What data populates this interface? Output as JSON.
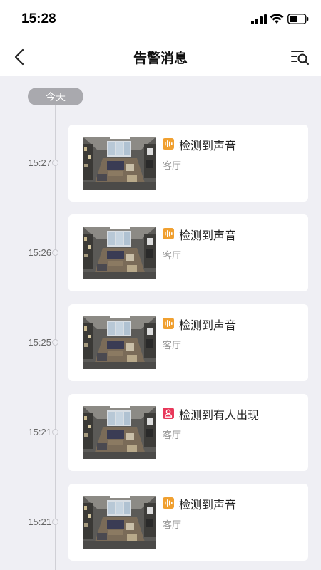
{
  "status_bar": {
    "time": "15:28",
    "icons": [
      "signal-icon",
      "wifi-icon",
      "battery-icon"
    ]
  },
  "nav": {
    "title": "告警消息",
    "back_icon": "chevron-left-icon",
    "filter_icon": "list-search-icon"
  },
  "timeline": {
    "date_label": "今天",
    "items": [
      {
        "time": "15:27",
        "title": "检测到声音",
        "location": "客厅",
        "type": "sound",
        "icon": "sound-wave-icon",
        "icon_color": "#f0a030"
      },
      {
        "time": "15:26",
        "title": "检测到声音",
        "location": "客厅",
        "type": "sound",
        "icon": "sound-wave-icon",
        "icon_color": "#f0a030"
      },
      {
        "time": "15:25",
        "title": "检测到声音",
        "location": "客厅",
        "type": "sound",
        "icon": "sound-wave-icon",
        "icon_color": "#f0a030"
      },
      {
        "time": "15:21",
        "title": "检测到有人出现",
        "location": "客厅",
        "type": "person",
        "icon": "person-icon",
        "icon_color": "#e8385a"
      },
      {
        "time": "15:21",
        "title": "检测到声音",
        "location": "客厅",
        "type": "sound",
        "icon": "sound-wave-icon",
        "icon_color": "#f0a030"
      }
    ]
  },
  "colors": {
    "background": "#efeff4",
    "card": "#ffffff",
    "sound_accent": "#f0a030",
    "person_accent": "#e8385a",
    "date_badge": "#a9a9ae"
  }
}
